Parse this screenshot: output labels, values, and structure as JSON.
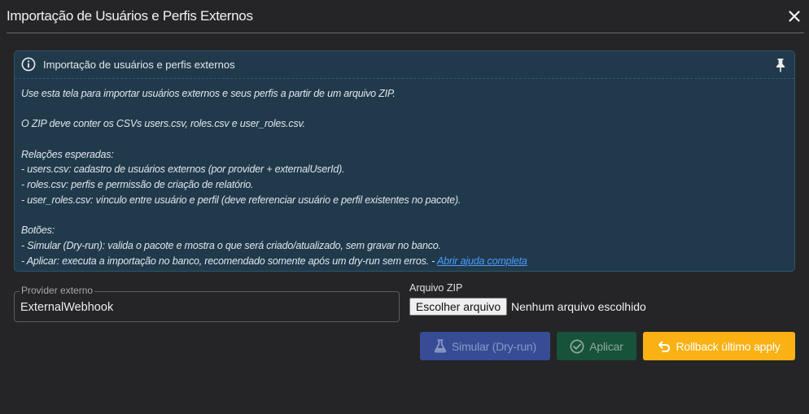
{
  "dialog": {
    "title": "Importação de Usuários e Perfis Externos"
  },
  "info_panel": {
    "title": "Importação de usuários e perfis externos",
    "intro": "Use esta tela para importar usuários externos e seus perfis a partir de um arquivo ZIP.",
    "zip_contents": "O ZIP deve conter os CSVs users.csv, roles.csv e user_roles.csv.",
    "relations_heading": "Relações esperadas:",
    "relations": [
      "- users.csv: cadastro de usuários externos (por provider + externalUserId).",
      "- roles.csv: perfis e permissão de criação de relatório.",
      "- user_roles.csv: vínculo entre usuário e perfil (deve referenciar usuário e perfil existentes no pacote)."
    ],
    "buttons_heading": "Botões:",
    "buttons_simulate": "- Simular (Dry-run): valida o pacote e mostra o que será criado/atualizado, sem gravar no banco.",
    "buttons_apply": "- Aplicar: executa a importação no banco, recomendado somente após um dry-run sem erros. - ",
    "help_link": "Abrir ajuda completa"
  },
  "provider": {
    "label": "Provider externo",
    "value": "ExternalWebhook"
  },
  "zip": {
    "label": "Arquivo ZIP",
    "choose_button": "Escolher arquivo",
    "status": "Nenhum arquivo escolhido"
  },
  "actions": {
    "simulate": "Simular (Dry-run)",
    "apply": "Aplicar",
    "rollback": "Rollback último apply"
  },
  "colors": {
    "background": "#252527",
    "info_panel": "#203a4c",
    "simulate_button": "#374c94",
    "apply_button": "#17523a",
    "rollback_button": "#f9b113",
    "link": "#4d9bff"
  },
  "icons": {
    "close": "close-icon",
    "info": "info-icon",
    "pin": "pin-icon",
    "simulate": "flask-icon",
    "apply": "check-circle-icon",
    "rollback": "undo-icon"
  }
}
